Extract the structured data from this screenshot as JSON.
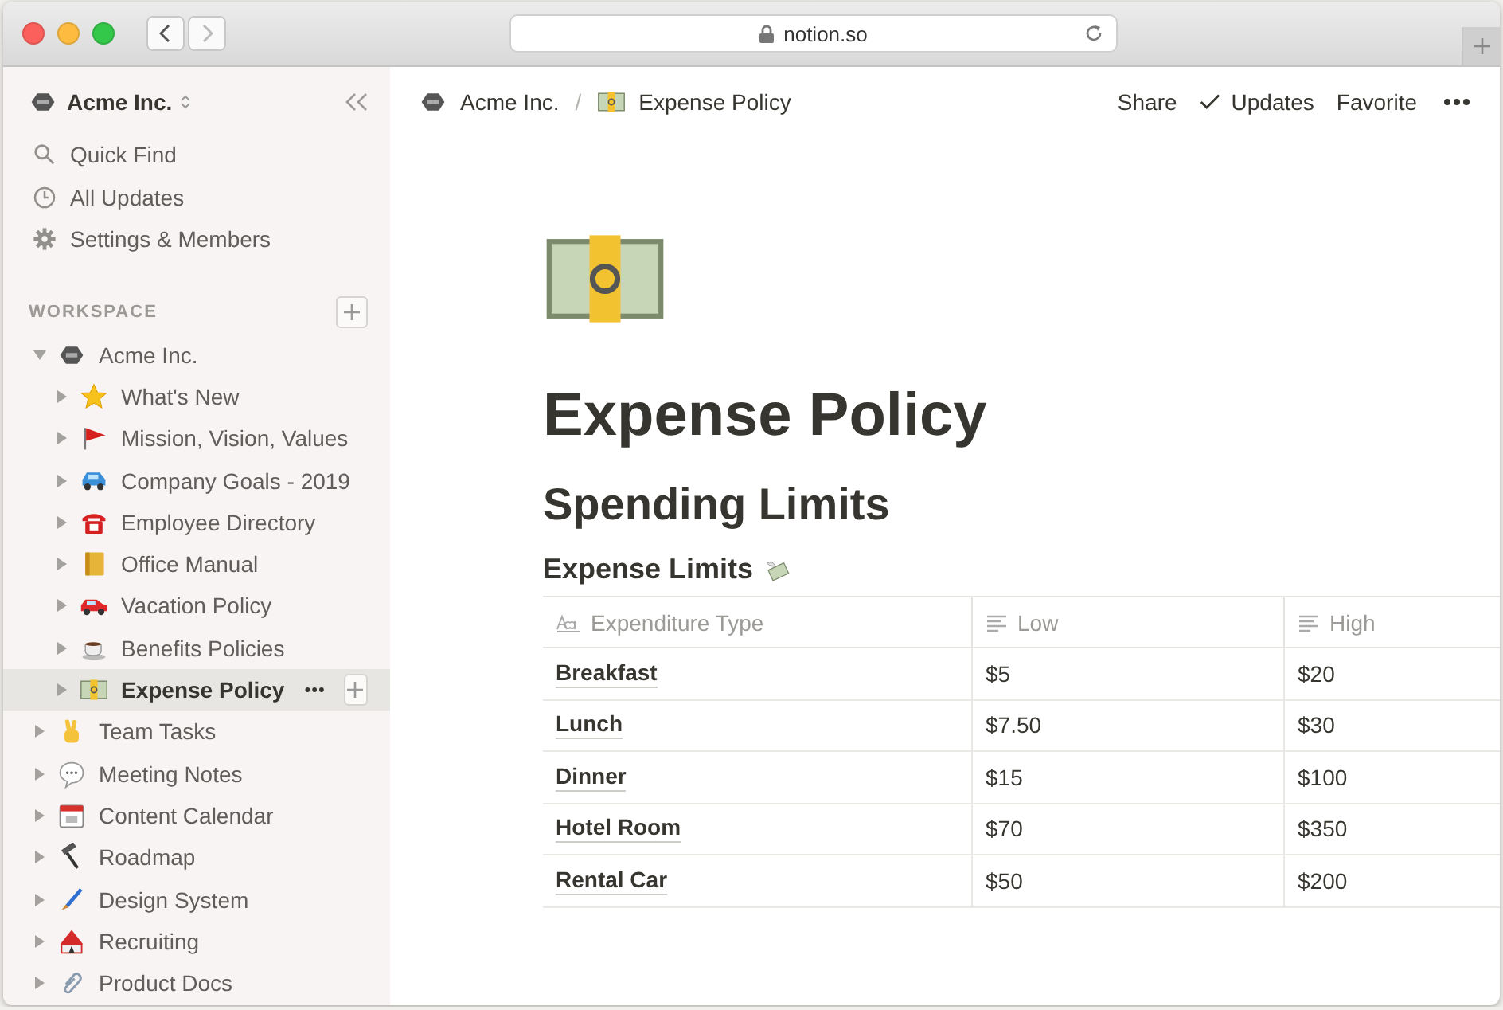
{
  "browser": {
    "url": "notion.so"
  },
  "sidebar": {
    "workspace_name": "Acme Inc.",
    "nav": [
      {
        "label": "Quick Find",
        "kind": "search"
      },
      {
        "label": "All Updates",
        "kind": "clock"
      },
      {
        "label": "Settings & Members",
        "kind": "gear"
      }
    ],
    "section_label": "WORKSPACE",
    "tree": [
      {
        "label": "Acme Inc.",
        "kind": "logo",
        "expanded": true,
        "selected": false,
        "children": [
          {
            "label": "What's New",
            "kind": "star",
            "expanded": false,
            "selected": false
          },
          {
            "label": "Mission, Vision, Values",
            "kind": "flag",
            "expanded": false,
            "selected": false
          },
          {
            "label": "Company Goals - 2019",
            "kind": "bluecar",
            "expanded": false,
            "selected": false
          },
          {
            "label": "Employee Directory",
            "kind": "phone",
            "expanded": false,
            "selected": false
          },
          {
            "label": "Office Manual",
            "kind": "book",
            "expanded": false,
            "selected": false
          },
          {
            "label": "Vacation Policy",
            "kind": "redcar",
            "expanded": false,
            "selected": false
          },
          {
            "label": "Benefits Policies",
            "kind": "coffee",
            "expanded": false,
            "selected": false
          },
          {
            "label": "Expense Policy",
            "kind": "money",
            "expanded": false,
            "selected": true
          }
        ]
      },
      {
        "label": "Team Tasks",
        "kind": "hand",
        "expanded": false,
        "selected": false
      },
      {
        "label": "Meeting Notes",
        "kind": "bubble",
        "expanded": false,
        "selected": false
      },
      {
        "label": "Content Calendar",
        "kind": "calendar",
        "expanded": false,
        "selected": false
      },
      {
        "label": "Roadmap",
        "kind": "hammer",
        "expanded": false,
        "selected": false
      },
      {
        "label": "Design System",
        "kind": "brush",
        "expanded": false,
        "selected": false
      },
      {
        "label": "Recruiting",
        "kind": "tent",
        "expanded": false,
        "selected": false
      },
      {
        "label": "Product Docs",
        "kind": "clip",
        "expanded": false,
        "selected": false
      }
    ]
  },
  "topbar": {
    "separator": "/",
    "breadcrumbs": [
      {
        "label": "Acme Inc.",
        "kind": "logo"
      },
      {
        "label": "Expense Policy",
        "kind": "money"
      }
    ],
    "actions": [
      {
        "label": "Share",
        "kind": "text"
      },
      {
        "label": "Updates",
        "kind": "check"
      },
      {
        "label": "Favorite",
        "kind": "text"
      }
    ]
  },
  "page": {
    "title": "Expense Policy",
    "heading": "Spending Limits",
    "subheading": "Expense Limits",
    "table": {
      "columns": [
        {
          "label": "Expenditure Type",
          "kind": "title"
        },
        {
          "label": "Low",
          "kind": "text"
        },
        {
          "label": "High",
          "kind": "text"
        }
      ],
      "rows": [
        [
          "Breakfast",
          "$5",
          "$20"
        ],
        [
          "Lunch",
          "$7.50",
          "$30"
        ],
        [
          "Dinner",
          "$15",
          "$100"
        ],
        [
          "Hotel Room",
          "$70",
          "$350"
        ],
        [
          "Rental Car",
          "$50",
          "$200"
        ]
      ]
    }
  }
}
